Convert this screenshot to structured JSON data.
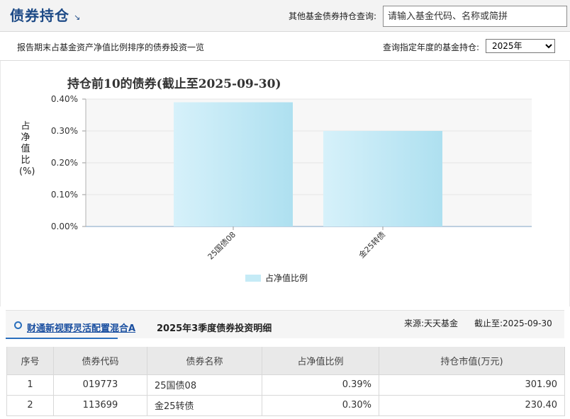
{
  "header": {
    "title": "债券持仓",
    "title_icon": "arrow-down-right-icon",
    "other_label": "其他基金债券持仓查询:",
    "search_placeholder": "请输入基金代码、名称或简拼"
  },
  "toolbar": {
    "subtitle": "报告期末占基金资产净值比例排序的债券投资一览",
    "year_label": "查询指定年度的基金持仓:",
    "year_selected": "2025年"
  },
  "chart_data": {
    "type": "bar",
    "title": "持仓前10的债券(截止至2025-09-30)",
    "xlabel": "",
    "ylabel": "占净值比(%)",
    "categories": [
      "25国债08",
      "金25转债"
    ],
    "series": [
      {
        "name": "占净值比例",
        "values": [
          0.39,
          0.3
        ]
      }
    ],
    "ylim": [
      0,
      0.4
    ],
    "yticks": [
      "0.00%",
      "0.10%",
      "0.20%",
      "0.30%",
      "0.40%"
    ],
    "grid": true,
    "bar_color": "#c5ebf6",
    "legend_position": "bottom"
  },
  "detail": {
    "fund_name": "财通新视野灵活配置混合A",
    "section_title": "2025年3季度债券投资明细",
    "source": "来源:天天基金",
    "cutoff": "截止至:2025-09-30"
  },
  "table": {
    "headers": [
      "序号",
      "债券代码",
      "债券名称",
      "占净值比例",
      "持仓市值(万元)"
    ],
    "rows": [
      [
        "1",
        "019773",
        "25国债08",
        "0.39%",
        "301.90"
      ],
      [
        "2",
        "113699",
        "金25转债",
        "0.30%",
        "230.40"
      ]
    ]
  }
}
